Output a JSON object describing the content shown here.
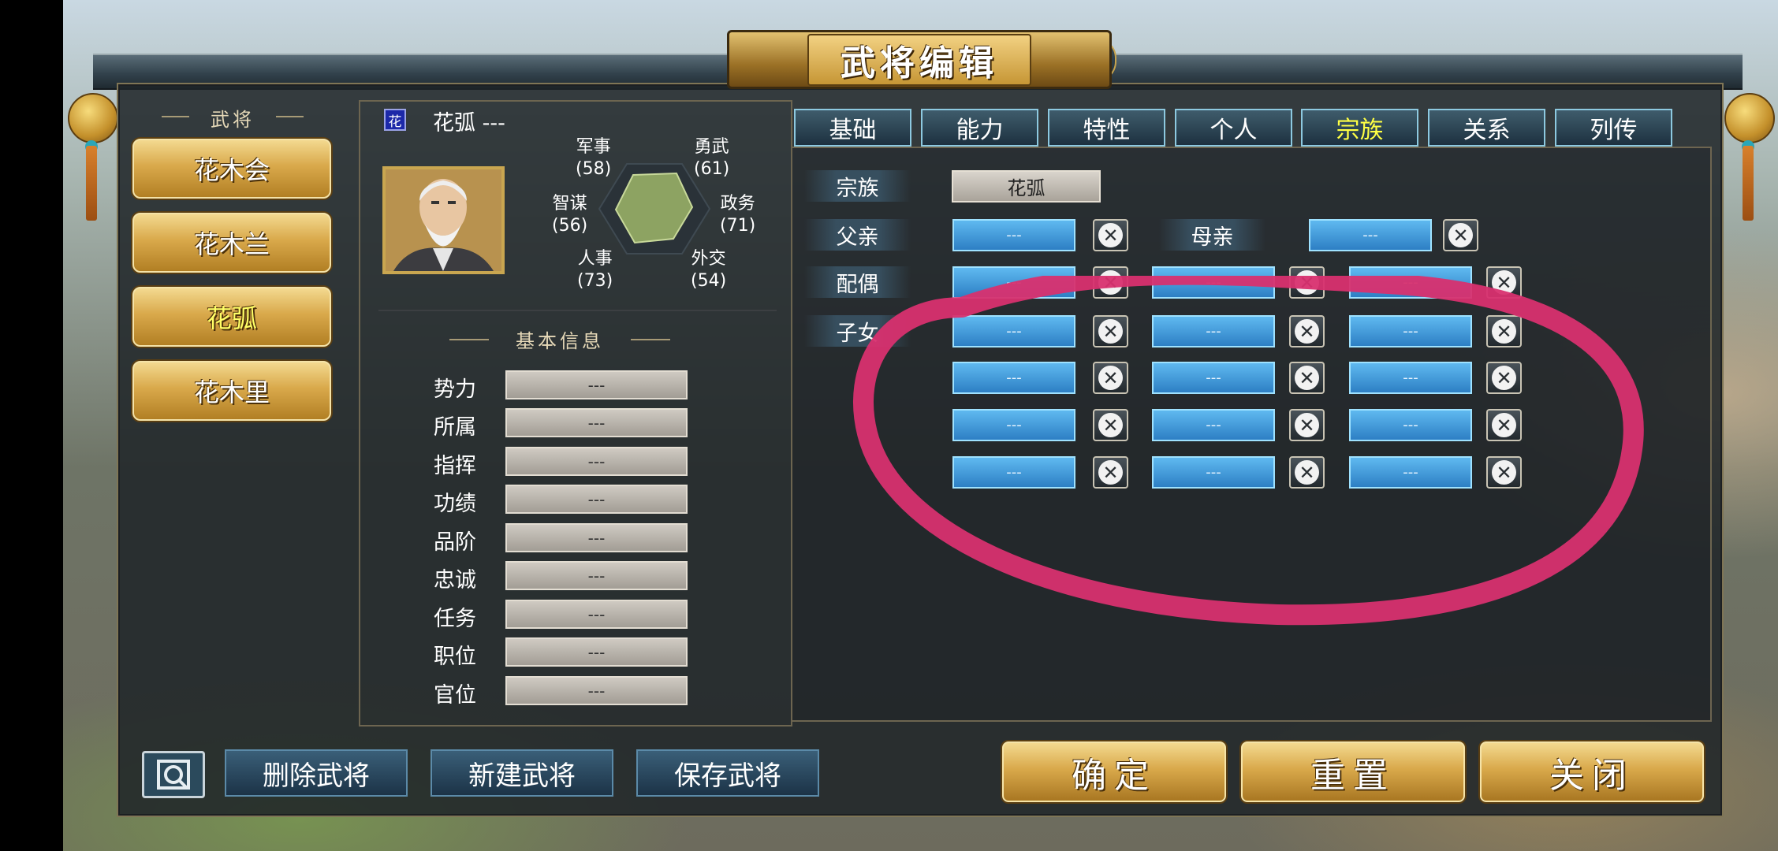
{
  "window": {
    "title": "武将编辑"
  },
  "generals_panel": {
    "header": "武将",
    "generals": [
      {
        "label": "花木会",
        "selected": false
      },
      {
        "label": "花木兰",
        "selected": false
      },
      {
        "label": "花弧",
        "selected": true
      },
      {
        "label": "花木里",
        "selected": false
      }
    ]
  },
  "profile": {
    "badge": "花",
    "name": "花弧 ---",
    "portrait_icon": "elder-general-portrait",
    "stats": [
      {
        "label": "军事",
        "value": "(58)"
      },
      {
        "label": "勇武",
        "value": "(61)"
      },
      {
        "label": "智谋",
        "value": "(56)"
      },
      {
        "label": "政务",
        "value": "(71)"
      },
      {
        "label": "人事",
        "value": "(73)"
      },
      {
        "label": "外交",
        "value": "(54)"
      }
    ]
  },
  "basic_info": {
    "header": "基本信息",
    "fields": [
      {
        "label": "势力",
        "value": "---"
      },
      {
        "label": "所属",
        "value": "---"
      },
      {
        "label": "指挥",
        "value": "---"
      },
      {
        "label": "功绩",
        "value": "---"
      },
      {
        "label": "品阶",
        "value": "---"
      },
      {
        "label": "忠诚",
        "value": "---"
      },
      {
        "label": "任务",
        "value": "---"
      },
      {
        "label": "职位",
        "value": "---"
      },
      {
        "label": "官位",
        "value": "---"
      }
    ]
  },
  "tabs": [
    {
      "label": "基础",
      "active": false
    },
    {
      "label": "能力",
      "active": false
    },
    {
      "label": "特性",
      "active": false
    },
    {
      "label": "个人",
      "active": false
    },
    {
      "label": "宗族",
      "active": true
    },
    {
      "label": "关系",
      "active": false
    },
    {
      "label": "列传",
      "active": false
    }
  ],
  "clan": {
    "clan_label": "宗族",
    "clan_value": "花弧",
    "father_label": "父亲",
    "father_value": "---",
    "mother_label": "母亲",
    "mother_value": "---",
    "spouse_label": "配偶",
    "spouses": [
      "---",
      "---",
      "---"
    ],
    "children_label": "子女",
    "children": [
      "---",
      "---",
      "---",
      "---",
      "---",
      "---",
      "---",
      "---",
      "---",
      "---",
      "---",
      "---"
    ],
    "remove_symbol": "✕"
  },
  "footer": {
    "delete_label": "删除武将",
    "new_label": "新建武将",
    "save_label": "保存武将",
    "confirm_label": "确定",
    "reset_label": "重置",
    "close_label": "关闭"
  },
  "colors": {
    "annotation": "#d8306f",
    "selected_text": "#ffff66",
    "gold": "#d9a94b"
  }
}
